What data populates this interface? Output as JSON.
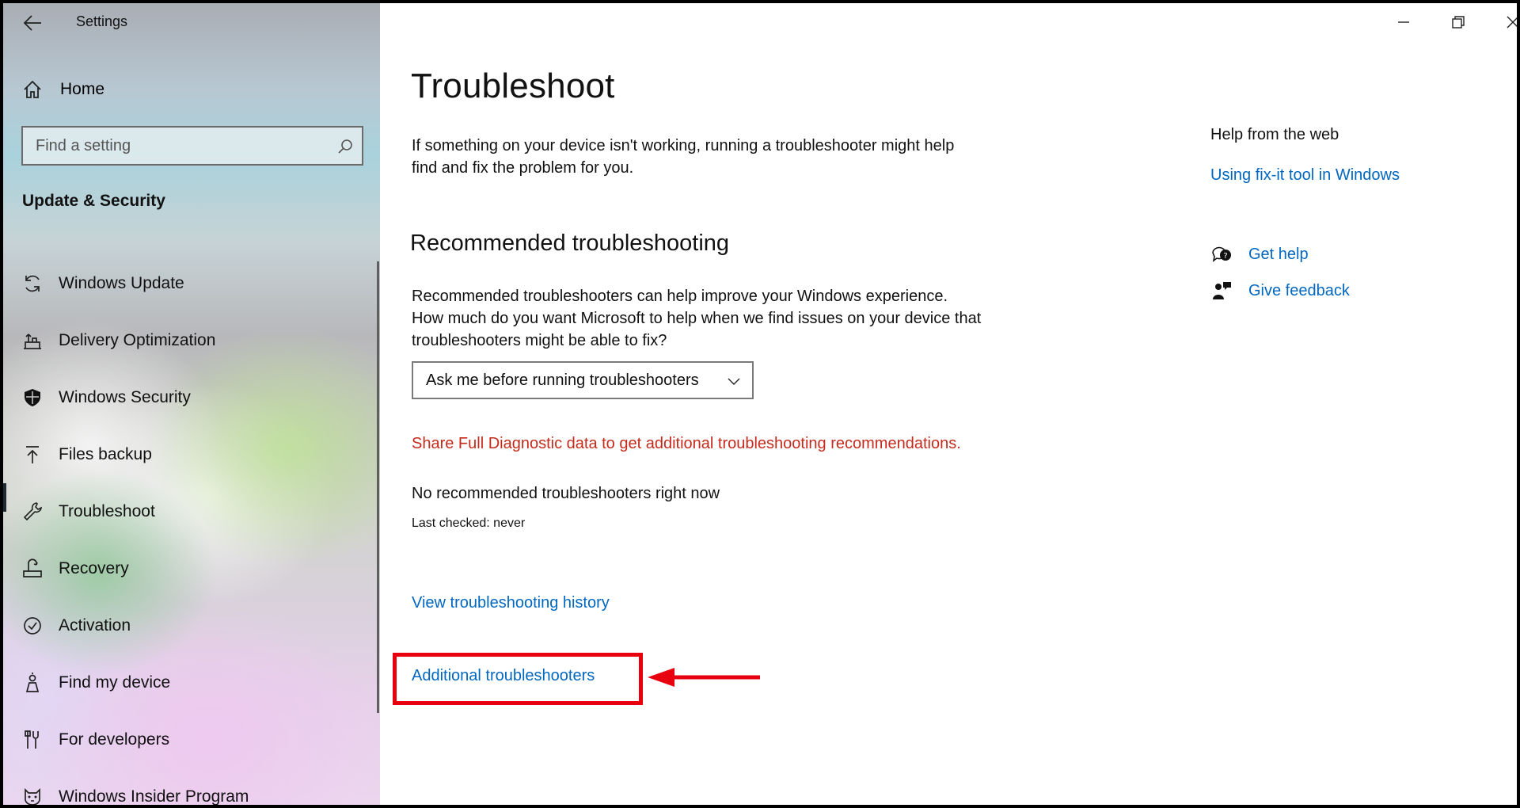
{
  "window": {
    "title": "Settings"
  },
  "sidebar": {
    "home_label": "Home",
    "search_placeholder": "Find a setting",
    "section_title": "Update & Security",
    "items": [
      {
        "label": "Windows Update",
        "icon": "sync-icon"
      },
      {
        "label": "Delivery Optimization",
        "icon": "delivery-optimization-icon"
      },
      {
        "label": "Windows Security",
        "icon": "shield-icon"
      },
      {
        "label": "Files backup",
        "icon": "backup-arrow-icon"
      },
      {
        "label": "Troubleshoot",
        "icon": "wrench-icon",
        "selected": true
      },
      {
        "label": "Recovery",
        "icon": "recovery-icon"
      },
      {
        "label": "Activation",
        "icon": "check-circle-icon"
      },
      {
        "label": "Find my device",
        "icon": "person-pin-icon"
      },
      {
        "label": "For developers",
        "icon": "developer-tools-icon"
      },
      {
        "label": "Windows Insider Program",
        "icon": "cat-icon"
      }
    ]
  },
  "main": {
    "title": "Troubleshoot",
    "intro": "If something on your device isn't working, running a troubleshooter might help find and fix the problem for you.",
    "recommended_heading": "Recommended troubleshooting",
    "recommended_description": "Recommended troubleshooters can help improve your Windows experience. How much do you want Microsoft to help when we find issues on your device that troubleshooters might be able to fix?",
    "dropdown_value": "Ask me before running troubleshooters",
    "diagnostic_link": "Share Full Diagnostic data to get additional troubleshooting recommendations.",
    "no_recommended": "No recommended troubleshooters right now",
    "last_checked": "Last checked: never",
    "history_link": "View troubleshooting history",
    "additional_link": "Additional troubleshooters"
  },
  "help": {
    "heading": "Help from the web",
    "fixit_link": "Using fix-it tool in Windows",
    "get_help": "Get help",
    "give_feedback": "Give feedback"
  },
  "colors": {
    "link": "#0067c0",
    "warning_link": "#c42b1c",
    "annotation": "#e8000f"
  }
}
